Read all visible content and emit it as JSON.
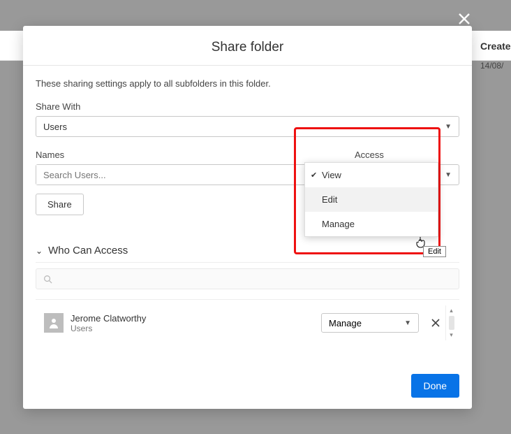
{
  "background": {
    "header_col": "Create",
    "row_date": "14/08/"
  },
  "modal": {
    "close_tooltip": "Close",
    "title": "Share folder",
    "intro": "These sharing settings apply to all subfolders in this folder.",
    "share_with": {
      "label": "Share With",
      "value": "Users"
    },
    "names": {
      "label": "Names",
      "placeholder": "Search Users..."
    },
    "access": {
      "label": "Access",
      "value": "View",
      "options": [
        {
          "label": "View",
          "selected": true
        },
        {
          "label": "Edit",
          "selected": false,
          "hover": true
        },
        {
          "label": "Manage",
          "selected": false
        }
      ],
      "tooltip": "Edit"
    },
    "share_button": "Share",
    "who_can_access": {
      "title": "Who Can Access",
      "filter_placeholder": ""
    },
    "entries": [
      {
        "name": "Jerome Clatworthy",
        "type": "Users",
        "role": "Manage"
      }
    ],
    "done_button": "Done"
  }
}
